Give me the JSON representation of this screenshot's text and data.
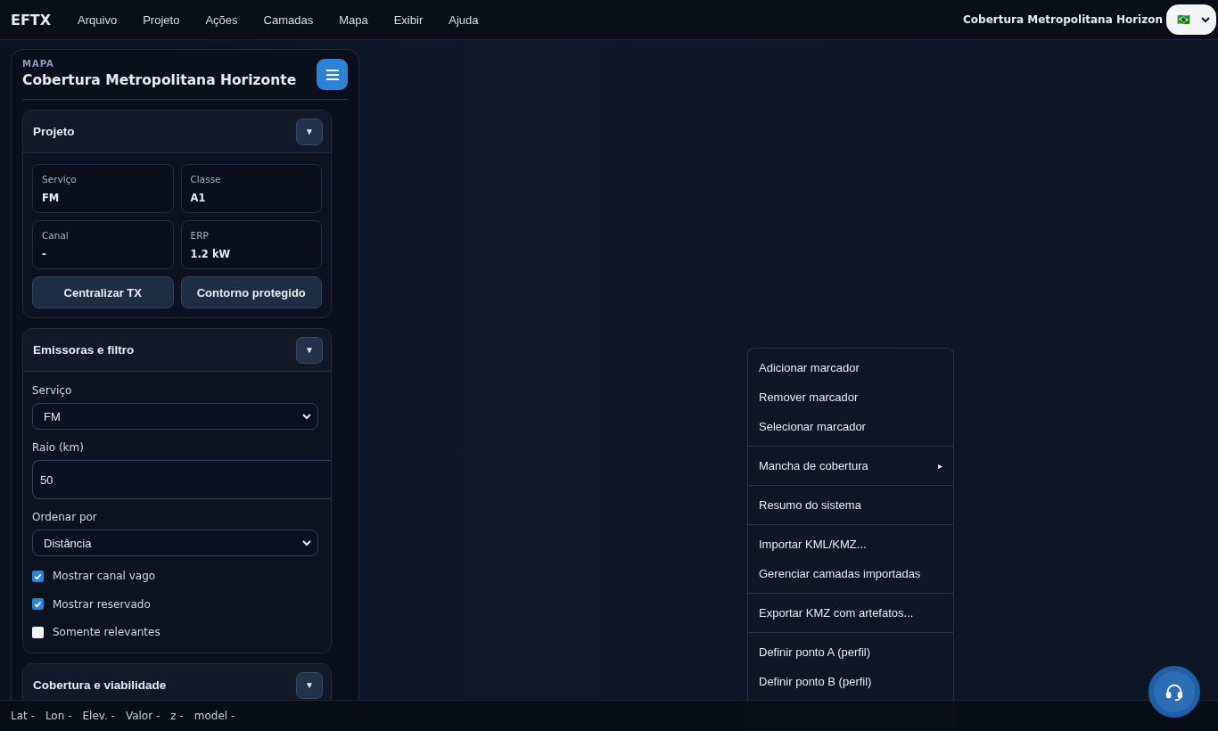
{
  "topbar": {
    "brand": "EFTX",
    "menus": [
      "Arquivo",
      "Projeto",
      "Ações",
      "Camadas",
      "Mapa",
      "Exibir",
      "Ajuda"
    ],
    "project_title": "Cobertura Metropolitana Horizon",
    "language_select": {
      "value": "🇧🇷"
    }
  },
  "sidebar": {
    "eyebrow": "MAPA",
    "title": "Cobertura Metropolitana Horizonte",
    "sections": [
      {
        "kind": "project",
        "title": "Projeto",
        "toggle": "▼",
        "fields": [
          {
            "label": "Serviço",
            "value": "FM"
          },
          {
            "label": "Classe",
            "value": "A1"
          },
          {
            "label": "Canal",
            "value": "-"
          },
          {
            "label": "ERP",
            "value": "1.2 kW"
          }
        ],
        "buttons": [
          "Centralizar TX",
          "Contorno protegido"
        ]
      },
      {
        "kind": "filter",
        "title": "Emissoras e filtro",
        "toggle": "▼",
        "controls": [
          {
            "kind": "select",
            "label": "Serviço",
            "value": "FM"
          },
          {
            "kind": "input",
            "label": "Raio (km)",
            "value": "50"
          },
          {
            "kind": "select",
            "label": "Ordenar por",
            "value": "Distância"
          },
          {
            "kind": "checkbox",
            "label": "Mostrar canal vago",
            "checked": true
          },
          {
            "kind": "checkbox",
            "label": "Mostrar reservado",
            "checked": true
          },
          {
            "kind": "checkbox",
            "label": "Somente relevantes",
            "checked": false
          }
        ]
      },
      {
        "kind": "empty",
        "title": "Cobertura e viabilidade",
        "toggle": "▼"
      }
    ]
  },
  "context_menu": {
    "groups": [
      [
        {
          "label": "Adicionar marcador"
        },
        {
          "label": "Remover marcador"
        },
        {
          "label": "Selecionar marcador"
        }
      ],
      [
        {
          "label": "Mancha de cobertura",
          "submenu": "▸"
        }
      ],
      [
        {
          "label": "Resumo do sistema"
        }
      ],
      [
        {
          "label": "Importar KML/KMZ..."
        },
        {
          "label": "Gerenciar camadas importadas"
        }
      ],
      [
        {
          "label": "Exportar KMZ com artefatos..."
        }
      ],
      [
        {
          "label": "Definir ponto A (perfil)"
        },
        {
          "label": "Definir ponto B (perfil)"
        }
      ]
    ]
  },
  "status_bar": [
    "Lat -",
    "Lon -",
    "Elev. -",
    "Valor -",
    "z -",
    "model -"
  ]
}
